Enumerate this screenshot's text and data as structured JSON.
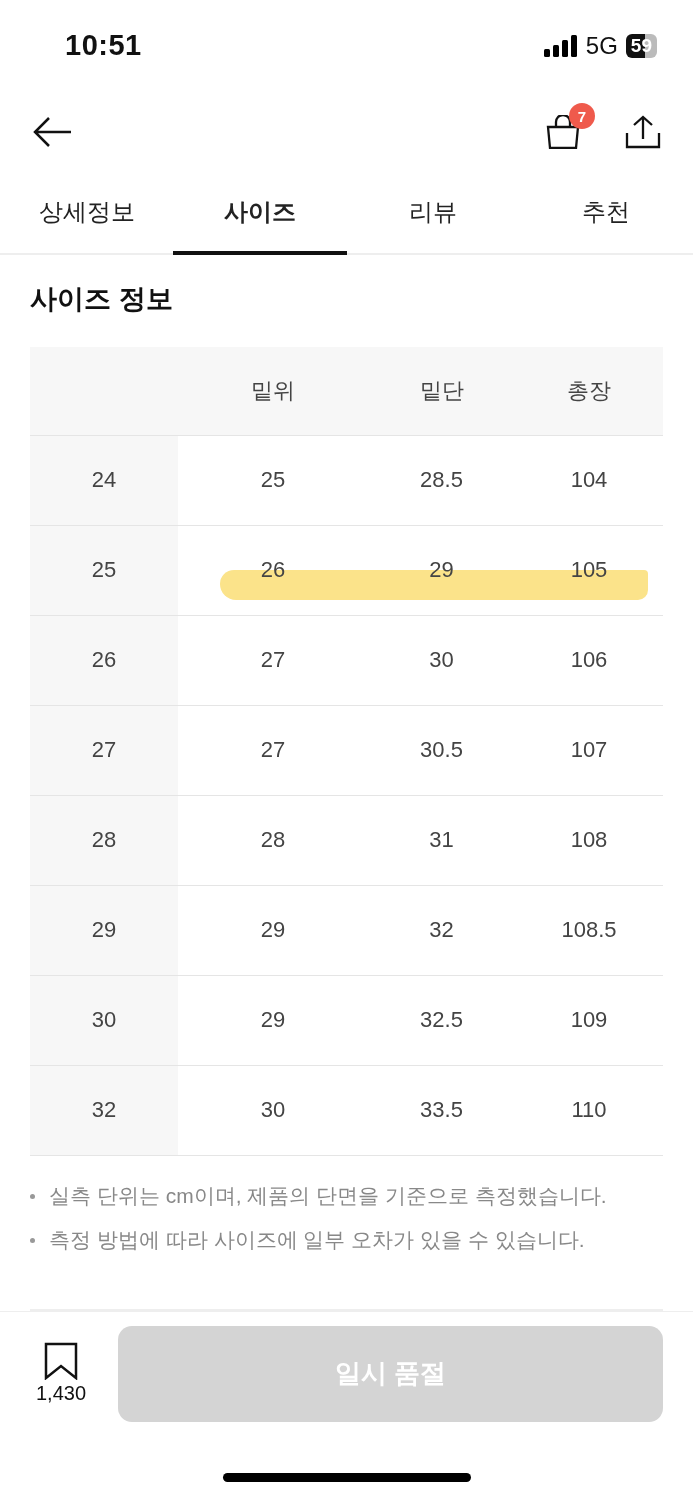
{
  "status_bar": {
    "time": "10:51",
    "network": "5G",
    "battery": "59"
  },
  "header": {
    "cart_badge": "7"
  },
  "tabs": [
    {
      "label": "상세정보",
      "selected": false
    },
    {
      "label": "사이즈",
      "selected": true
    },
    {
      "label": "리뷰",
      "selected": false
    },
    {
      "label": "추천",
      "selected": false
    }
  ],
  "section_title": "사이즈 정보",
  "table": {
    "columns": [
      "",
      "밑위",
      "밑단",
      "총장"
    ],
    "rows": [
      {
        "cells": [
          "24",
          "25",
          "28.5",
          "104"
        ],
        "highlighted": false
      },
      {
        "cells": [
          "25",
          "26",
          "29",
          "105"
        ],
        "highlighted": true
      },
      {
        "cells": [
          "26",
          "27",
          "30",
          "106"
        ],
        "highlighted": false
      },
      {
        "cells": [
          "27",
          "27",
          "30.5",
          "107"
        ],
        "highlighted": false
      },
      {
        "cells": [
          "28",
          "28",
          "31",
          "108"
        ],
        "highlighted": false
      },
      {
        "cells": [
          "29",
          "29",
          "32",
          "108.5"
        ],
        "highlighted": false
      },
      {
        "cells": [
          "30",
          "29",
          "32.5",
          "109"
        ],
        "highlighted": false
      },
      {
        "cells": [
          "32",
          "30",
          "33.5",
          "110"
        ],
        "highlighted": false
      }
    ]
  },
  "notes": [
    "실측 단위는 cm이며, 제품의 단면을 기준으로 측정했습니다.",
    "측정 방법에 따라 사이즈에 일부 오차가 있을 수 있습니다."
  ],
  "bottom_bar": {
    "bookmark_count": "1,430",
    "button": {
      "label": "일시 품절",
      "disabled": true
    }
  }
}
